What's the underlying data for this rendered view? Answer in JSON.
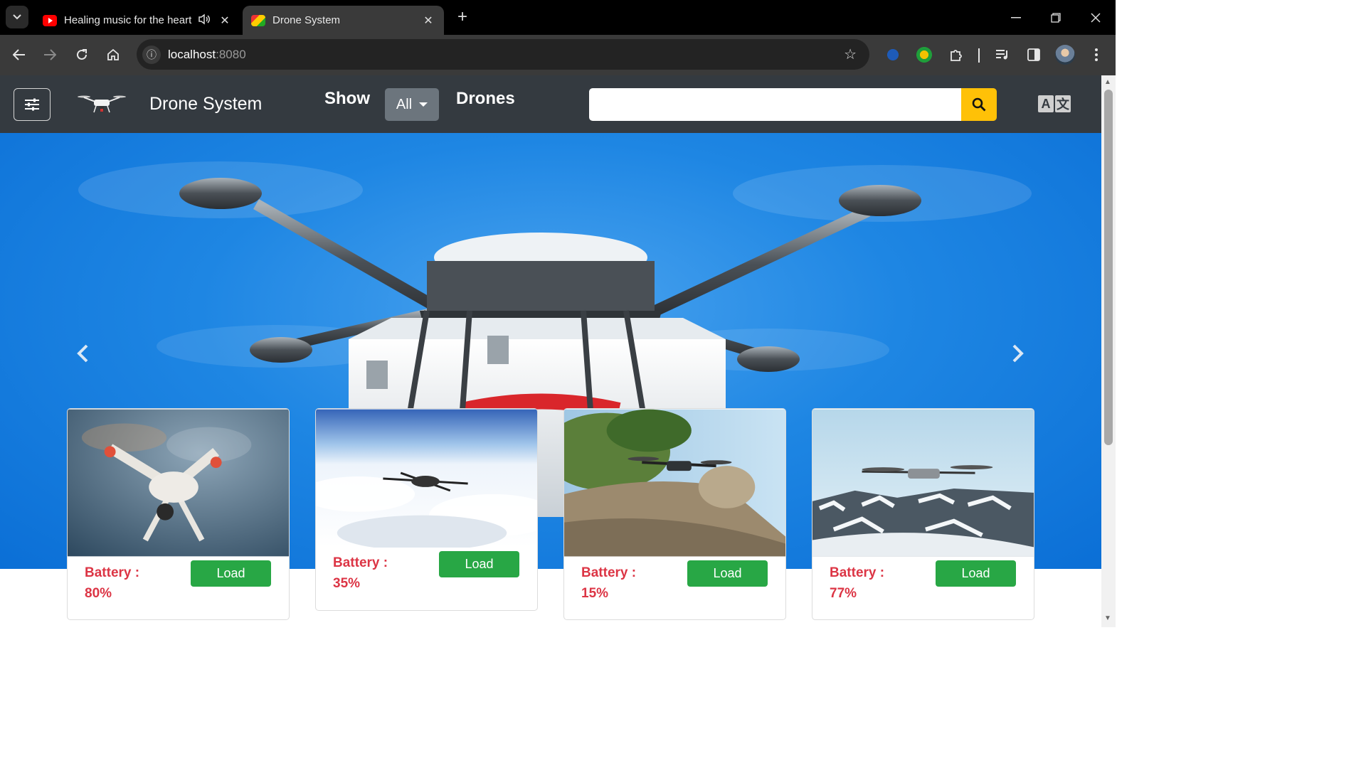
{
  "browser": {
    "tabs": [
      {
        "title": "Healing music for the heart",
        "favicon": "youtube-icon",
        "audio": true
      },
      {
        "title": "Drone System",
        "favicon": "drone-system-favicon",
        "active": true
      }
    ],
    "new_tab_label": "+",
    "address": {
      "host": "localhost",
      "port": ":8080"
    }
  },
  "navbar": {
    "brand": "Drone System",
    "show_label": "Show",
    "filter_value": "All",
    "drones_label": "Drones",
    "search_placeholder": "",
    "translate_letters": [
      "A",
      "文"
    ]
  },
  "drones": [
    {
      "battery_label": "Battery :",
      "battery_value": "80%",
      "button": "Load",
      "scene": "grey-sky"
    },
    {
      "battery_label": "Battery :",
      "battery_value": "35%",
      "button": "Load",
      "scene": "clouds"
    },
    {
      "battery_label": "Battery :",
      "battery_value": "15%",
      "button": "Load",
      "scene": "rocks"
    },
    {
      "battery_label": "Battery :",
      "battery_value": "77%",
      "button": "Load",
      "scene": "mountains"
    }
  ],
  "colors": {
    "navbar_bg": "#343a40",
    "search_button": "#ffc107",
    "load_button": "#28a745",
    "battery_text": "#dc3545",
    "hero_sky": "#1e86e3"
  }
}
